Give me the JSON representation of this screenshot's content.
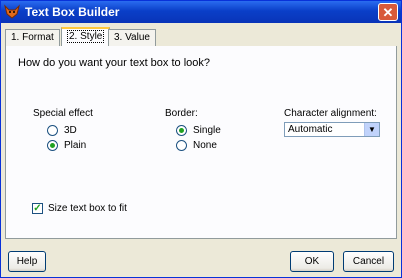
{
  "window": {
    "title": "Text Box Builder",
    "close_symbol": "✕"
  },
  "tabs": [
    {
      "label": "1. Format"
    },
    {
      "label": "2. Style"
    },
    {
      "label": "3. Value"
    }
  ],
  "question": "How do you want your text box to look?",
  "special_effect": {
    "label": "Special effect",
    "options": [
      {
        "label": "3D",
        "selected": false
      },
      {
        "label": "Plain",
        "selected": true
      }
    ]
  },
  "border": {
    "label": "Border:",
    "options": [
      {
        "label": "Single",
        "selected": true
      },
      {
        "label": "None",
        "selected": false
      }
    ]
  },
  "alignment": {
    "label": "Character alignment:",
    "value": "Automatic"
  },
  "size_to_fit": {
    "label": "Size text box to fit",
    "checked": true
  },
  "buttons": {
    "help": "Help",
    "ok": "OK",
    "cancel": "Cancel"
  }
}
